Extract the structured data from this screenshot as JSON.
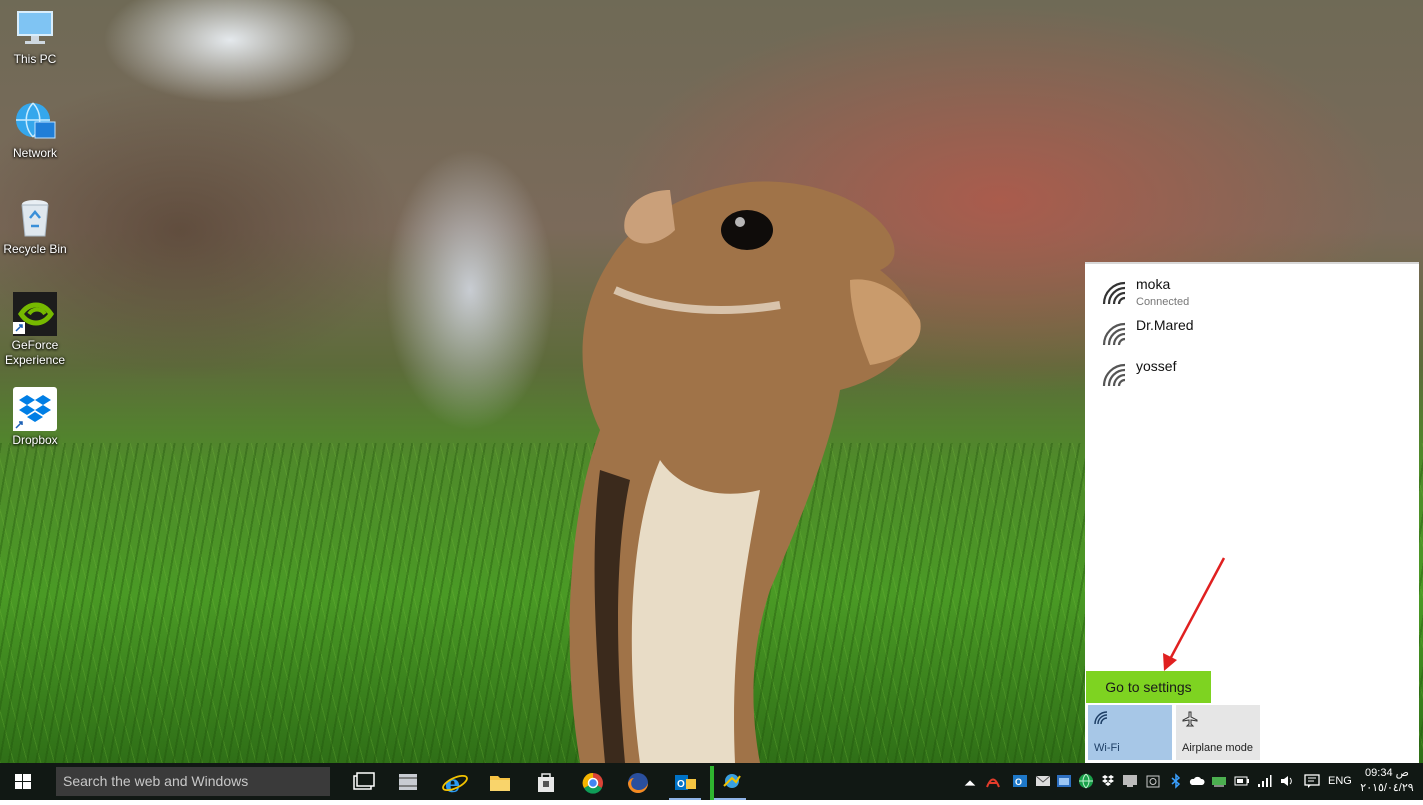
{
  "desktop": {
    "icons": [
      {
        "label": "This PC",
        "icon": "monitor-icon"
      },
      {
        "label": "Network",
        "icon": "network-globe-icon"
      },
      {
        "label": "Recycle Bin",
        "icon": "recycle-bin-icon"
      },
      {
        "label": "GeForce\nExperience",
        "icon": "geforce-icon"
      },
      {
        "label": "Dropbox",
        "icon": "dropbox-icon"
      }
    ]
  },
  "network_flyout": {
    "networks": [
      {
        "name": "moka",
        "status": "Connected"
      },
      {
        "name": "Dr.Mared",
        "status": ""
      },
      {
        "name": "yossef",
        "status": ""
      }
    ],
    "settings_link": "Go to settings",
    "quick_actions": [
      {
        "label": "Wi-Fi",
        "active": true
      },
      {
        "label": "Airplane mode",
        "active": false
      }
    ]
  },
  "taskbar": {
    "search_placeholder": "Search the web and Windows",
    "language": "ENG",
    "time": "09:34 ص",
    "date": "٢٠١٥/٠٤/٢٩"
  },
  "colors": {
    "settings_highlight": "#7ED321",
    "wifi_tile": "#A7C7E7",
    "taskbar": "#111814"
  }
}
